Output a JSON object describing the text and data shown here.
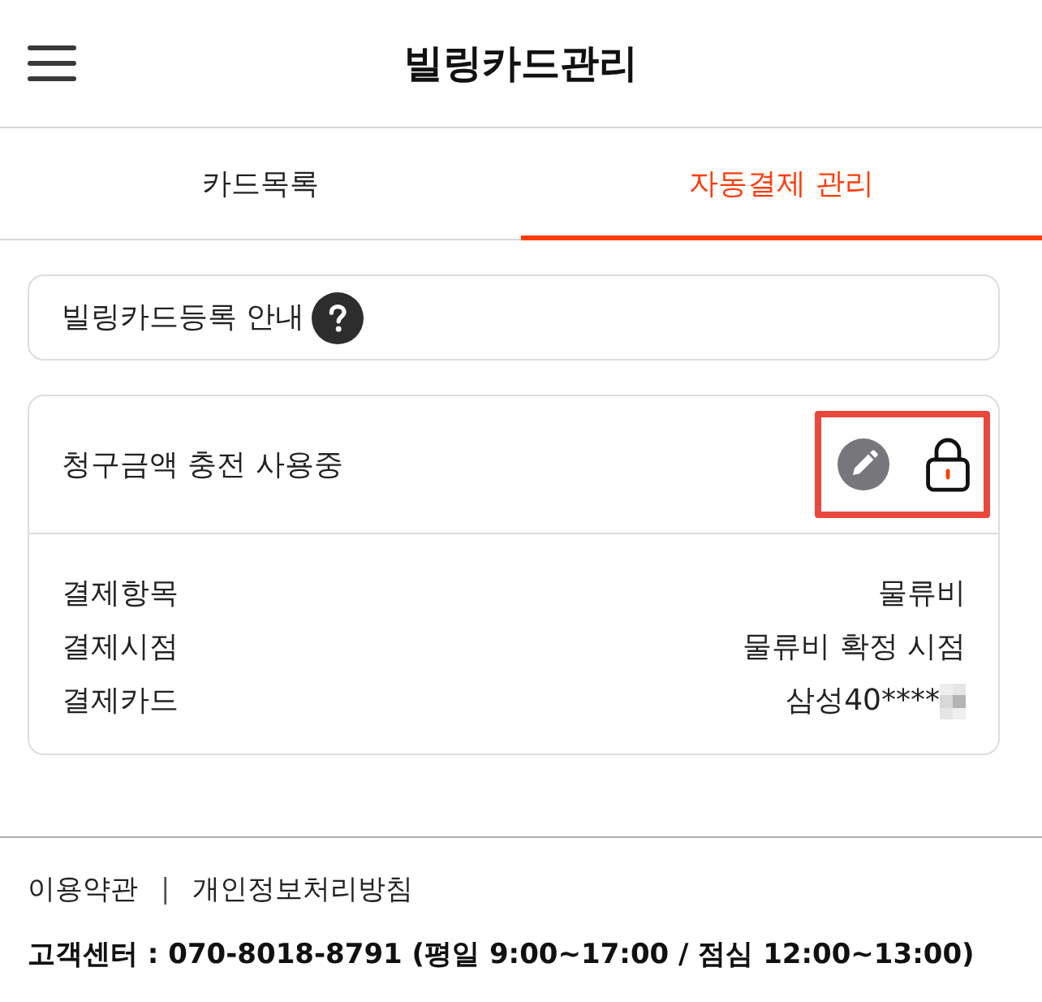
{
  "header": {
    "title": "빌링카드관리"
  },
  "tabs": [
    {
      "label": "카드목록",
      "selected": false
    },
    {
      "label": "자동결제 관리",
      "selected": true
    }
  ],
  "info_card": {
    "label": "빌링카드등록 안내"
  },
  "autopay_card": {
    "title": "청구금액 충전 사용중",
    "actions_highlighted": true,
    "rows": [
      {
        "label": "결제항목",
        "value": "물류비",
        "masked": false
      },
      {
        "label": "결제시점",
        "value": "물류비 확정 시점",
        "masked": false
      },
      {
        "label": "결제카드",
        "value": "삼성40****",
        "masked": true
      }
    ]
  },
  "footer": {
    "links": [
      "이용약관",
      "개인정보처리방침"
    ],
    "separator": "|",
    "contact": "고객센터 : 070-8018-8791 (평일 9:00~17:00 / 점심 12:00~13:00)"
  }
}
